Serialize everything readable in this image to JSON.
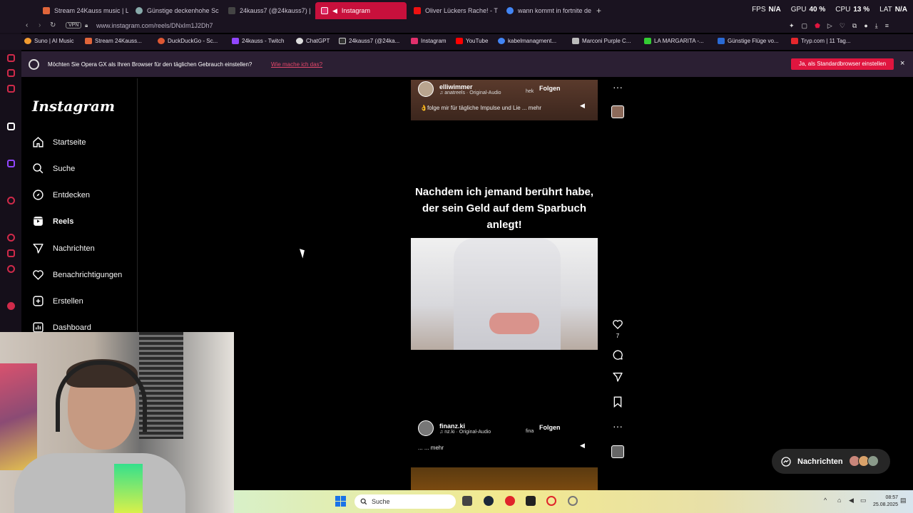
{
  "browser": {
    "tabs": [
      {
        "label": "Stream 24Kauss music | L",
        "color": "#e0653a"
      },
      {
        "label": "Günstige deckenhohe Sc",
        "color": "#8aa"
      },
      {
        "label": "24kauss7 (@24kauss7) |",
        "color": "#333"
      },
      {
        "label": "Instagram",
        "color": "#e1306c"
      },
      {
        "label": "Oliver Lückers Rache! - T",
        "color": "#e11"
      },
      {
        "label": "wann kommt in fortnite de",
        "color": "#4285f4"
      }
    ],
    "stats": [
      {
        "key": "FPS",
        "value": "N/A"
      },
      {
        "key": "GPU",
        "value": "40 %"
      },
      {
        "key": "CPU",
        "value": "13 %"
      },
      {
        "key": "LAT",
        "value": "N/A"
      }
    ],
    "vpn_label": "VPN",
    "url": "www.instagram.com/reels/DNxIm1J2Dh7",
    "bookmarks": [
      {
        "label": "Suno | AI Music",
        "color": "#f29b30"
      },
      {
        "label": "Stream 24Kauss...",
        "color": "#e0653a"
      },
      {
        "label": "DuckDuckGo - Sc...",
        "color": "#de5833"
      },
      {
        "label": "24kauss - Twitch",
        "color": "#9146ff"
      },
      {
        "label": "ChatGPT",
        "color": "#ddd"
      },
      {
        "label": "24kauss7 (@24ka...",
        "color": "#333"
      },
      {
        "label": "Instagram",
        "color": "#e1306c"
      },
      {
        "label": "YouTube",
        "color": "#f00"
      },
      {
        "label": "kabelmanagment...",
        "color": "#4285f4"
      },
      {
        "label": "Marconi Purple C...",
        "color": "#bbb"
      },
      {
        "label": "LA MARGARITA -...",
        "color": "#33cc33"
      },
      {
        "label": "Günstige Flüge vo...",
        "color": "#2a6ad4"
      },
      {
        "label": "Tryp.com | 11 Tag...",
        "color": "#e5272d"
      }
    ]
  },
  "banner": {
    "text": "Möchten Sie Opera GX als Ihren Browser für den täglichen Gebrauch einstellen?",
    "link": "Wie mache ich das?",
    "button": "Ja, als Standardbrowser einstellen",
    "close": "×"
  },
  "instagram": {
    "logo": "Instagram",
    "nav": [
      {
        "label": "Startseite",
        "icon": "home-icon"
      },
      {
        "label": "Suche",
        "icon": "search-icon"
      },
      {
        "label": "Entdecken",
        "icon": "compass-icon"
      },
      {
        "label": "Reels",
        "icon": "reels-icon"
      },
      {
        "label": "Nachrichten",
        "icon": "messages-icon"
      },
      {
        "label": "Benachrichtigungen",
        "icon": "heart-icon"
      },
      {
        "label": "Erstellen",
        "icon": "plus-icon"
      },
      {
        "label": "Dashboard",
        "icon": "dashboard-icon"
      }
    ],
    "reel1": {
      "username": "elliwimmer",
      "audio": "♫ anatreels · Original-Audio",
      "audio_extra": "hek",
      "follow": "Folgen",
      "caption": "👌folge mir für tägliche Impulse und Lie ... mehr"
    },
    "reel2": {
      "caption": "Nachdem ich jemand berührt habe, der sein Geld auf dem Sparbuch anlegt!",
      "likes": "7"
    },
    "reel3": {
      "username": "finanz.ki",
      "audio": "♫ nz.ki · Original-Audio",
      "audio_extra": "fina",
      "follow": "Folgen",
      "caption": "... ... mehr"
    },
    "messages_pill": "Nachrichten"
  },
  "taskbar": {
    "search": "Suche",
    "time": "08:57",
    "date": "25.08.2025"
  }
}
